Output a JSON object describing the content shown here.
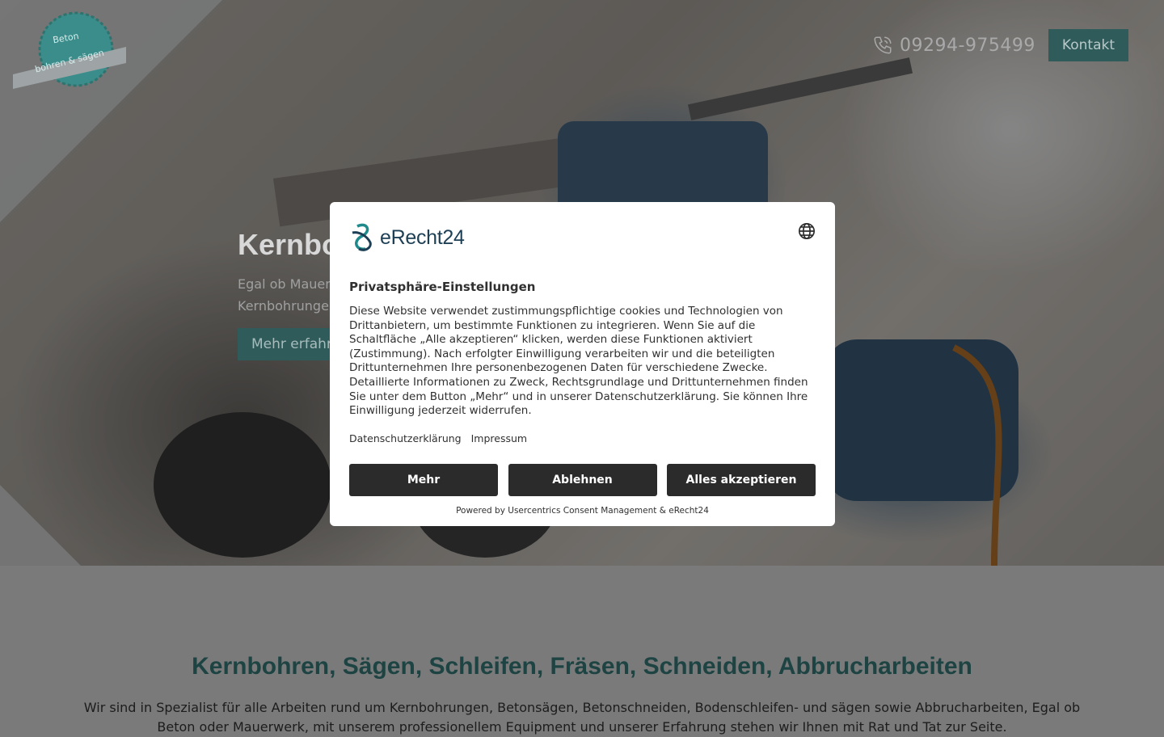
{
  "header": {
    "logo_text_line1": "Beton",
    "logo_text_line2": "bohren & sägen",
    "phone": "09294-975499",
    "contact_label": "Kontakt"
  },
  "hero": {
    "title": "Kernbohren",
    "subtitle_line1": "Egal ob Mauerwerk",
    "subtitle_line2": "Kernbohrungen",
    "button_label": "Mehr erfahren"
  },
  "section": {
    "title": "Kernbohren, Sägen, Schleifen, Fräsen, Schneiden, Abbrucharbeiten",
    "text": "Wir sind in Spezialist für alle Arbeiten rund um Kernbohrungen, Betonsägen, Betonschneiden, Bodenschleifen- und sägen sowie Abbrucharbeiten, Egal ob Beton oder Mauerwerk, mit unserem professionellem Equipment und unserer Erfahrung stehen wir Ihnen mit Rat und Tat zur Seite."
  },
  "consent": {
    "brand": "eRecht24",
    "title": "Privatsphäre-Einstellungen",
    "body": "Diese Website verwendet zustimmungspflichtige cookies und Technologien von Drittanbietern, um bestimmte Funktionen zu integrieren. Wenn Sie auf die Schaltfläche „Alle akzeptieren“ klicken, werden diese Funktionen aktiviert (Zustimmung). Nach erfolgter Einwilligung verarbeiten wir und die beteiligten Drittunternehmen Ihre personenbezogenen Daten für verschiedene Zwecke. Detaillierte Informationen zu Zweck, Rechtsgrundlage und Drittunternehmen finden Sie unter dem Button „Mehr“ und in unserer Datenschutzerklärung. Sie können Ihre Einwilligung jederzeit widerrufen.",
    "link_privacy": "Datenschutzerklärung",
    "link_imprint": "Impressum",
    "btn_more": "Mehr",
    "btn_decline": "Ablehnen",
    "btn_accept": "Alles akzeptieren",
    "powered_by": "Powered by Usercentrics Consent Management & eRecht24"
  },
  "colors": {
    "brand_teal": "#2f5b5b",
    "dialog_button": "#2b2b2b",
    "heading_teal": "#1d4342"
  }
}
